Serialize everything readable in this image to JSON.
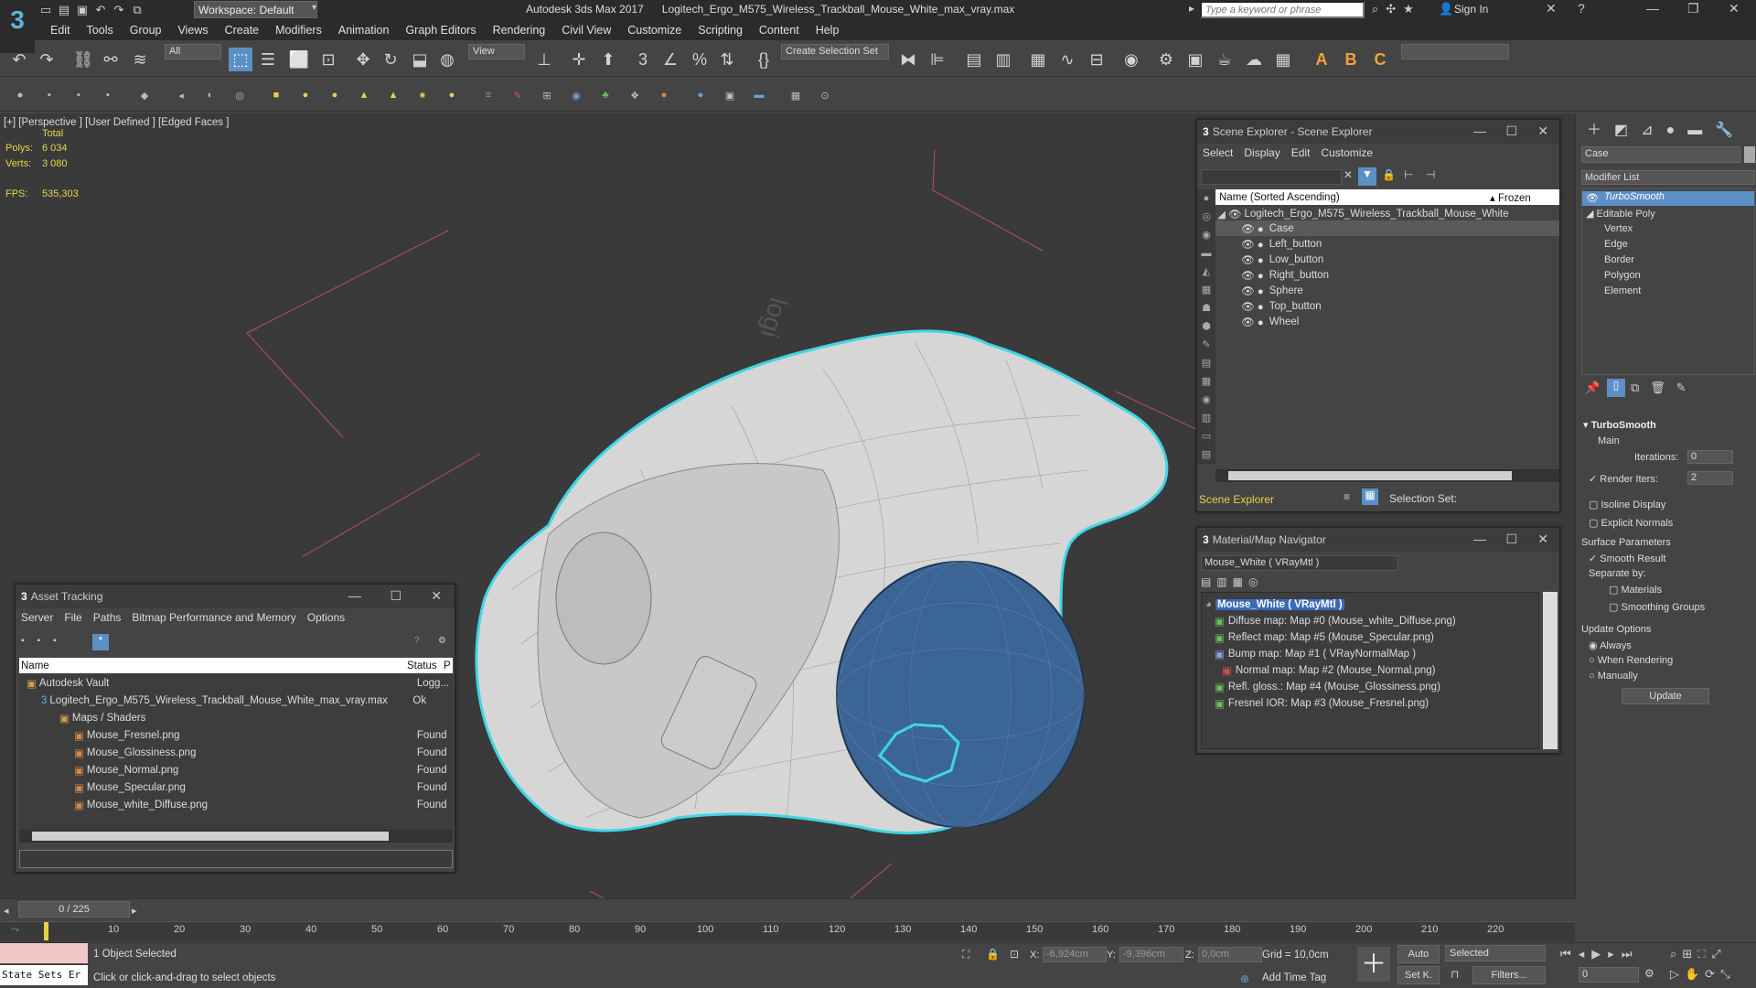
{
  "app": {
    "workspace": "Workspace: Default",
    "title": "Autodesk 3ds Max 2017",
    "file": "Logitech_Ergo_M575_Wireless_Trackball_Mouse_White_max_vray.max",
    "search_placeholder": "Type a keyword or phrase",
    "sign_in": "Sign In"
  },
  "menu": [
    "Edit",
    "Tools",
    "Group",
    "Views",
    "Create",
    "Modifiers",
    "Animation",
    "Graph Editors",
    "Rendering",
    "Civil View",
    "Customize",
    "Scripting",
    "Content",
    "Help"
  ],
  "toolbar": {
    "filter": "All",
    "ref_coord": "View",
    "selection_set": "Create Selection Set"
  },
  "viewport": {
    "label": "[+] [Perspective ]  [User Defined ]  [Edged Faces ]",
    "total_label": "Total",
    "polys_label": "Polys:",
    "polys": "6 034",
    "verts_label": "Verts:",
    "verts": "3 080",
    "fps_label": "FPS:",
    "fps": "535,303"
  },
  "scene_explorer": {
    "title": "Scene Explorer - Scene Explorer",
    "menu": [
      "Select",
      "Display",
      "Edit",
      "Customize"
    ],
    "col_name": "Name (Sorted Ascending)",
    "col_frozen": "▴ Frozen",
    "root": "Logitech_Ergo_M575_Wireless_Trackball_Mouse_White",
    "children": [
      "Case",
      "Left_button",
      "Low_button",
      "Right_button",
      "Sphere",
      "Top_button",
      "Wheel"
    ],
    "footer_label": "Scene Explorer",
    "selection_set_label": "Selection Set:"
  },
  "material_nav": {
    "title": "Material/Map Navigator",
    "current": "Mouse_White  ( VRayMtl )",
    "root": "Mouse_White  ( VRayMtl )",
    "maps": [
      "Diffuse map: Map #0 (Mouse_white_Diffuse.png)",
      "Reflect map: Map #5 (Mouse_Specular.png)",
      "Bump map: Map #1  ( VRayNormalMap )",
      "Normal map: Map #2 (Mouse_Normal.png)",
      "Refl. gloss.: Map #4 (Mouse_Glossiness.png)",
      "Fresnel IOR: Map #3 (Mouse_Fresnel.png)"
    ]
  },
  "asset_tracking": {
    "title": "Asset Tracking",
    "menu": [
      "Server",
      "File",
      "Paths",
      "Bitmap Performance and Memory",
      "Options"
    ],
    "col_name": "Name",
    "col_status": "Status",
    "col_extra": "P",
    "rows": [
      {
        "name": "Autodesk Vault",
        "status": "Logg..."
      },
      {
        "name": "Logitech_Ergo_M575_Wireless_Trackball_Mouse_White_max_vray.max",
        "status": "Ok"
      },
      {
        "name": "Maps / Shaders",
        "status": ""
      },
      {
        "name": "Mouse_Fresnel.png",
        "status": "Found"
      },
      {
        "name": "Mouse_Glossiness.png",
        "status": "Found"
      },
      {
        "name": "Mouse_Normal.png",
        "status": "Found"
      },
      {
        "name": "Mouse_Specular.png",
        "status": "Found"
      },
      {
        "name": "Mouse_white_Diffuse.png",
        "status": "Found"
      }
    ]
  },
  "command_panel": {
    "object_name": "Case",
    "modifier_list": "Modifier List",
    "stack": [
      "TurboSmooth",
      "Editable Poly",
      "Vertex",
      "Edge",
      "Border",
      "Polygon",
      "Element"
    ],
    "rollout_title": "TurboSmooth",
    "main_label": "Main",
    "iterations_label": "Iterations:",
    "iterations": "0",
    "render_iters_label": "Render Iters:",
    "render_iters": "2",
    "isoline": "Isoline Display",
    "explicit_normals": "Explicit Normals",
    "surface_params": "Surface Parameters",
    "smooth_result": "Smooth Result",
    "separate_by": "Separate by:",
    "materials": "Materials",
    "smoothing_groups": "Smoothing Groups",
    "update_options": "Update Options",
    "always": "Always",
    "when_rendering": "When Rendering",
    "manually": "Manually",
    "update": "Update"
  },
  "timeline": {
    "frame": "0 / 225",
    "ticks": [
      "10",
      "20",
      "30",
      "40",
      "50",
      "60",
      "70",
      "80",
      "90",
      "100",
      "110",
      "120",
      "130",
      "140",
      "150",
      "160",
      "170",
      "180",
      "190",
      "200",
      "210",
      "220"
    ]
  },
  "status": {
    "state_sets": "State Sets Er",
    "selected": "1 Object Selected",
    "prompt": "Click or click-and-drag to select objects",
    "x_label": "X:",
    "x": "-6,924cm",
    "y_label": "Y:",
    "y": "-9,396cm",
    "z_label": "Z:",
    "z": "0,0cm",
    "grid": "Grid = 10,0cm",
    "add_time_tag": "Add Time Tag",
    "auto": "Auto",
    "set_k": "Set K.",
    "selected_dd": "Selected",
    "filters": "Filters...",
    "frame_value": "0"
  },
  "colors": {
    "selection_cyan": "#3fd6e6",
    "active_blue": "#5d8fc7",
    "stats_yellow": "#e7d54a",
    "sphere_blue": "#3b6595"
  }
}
